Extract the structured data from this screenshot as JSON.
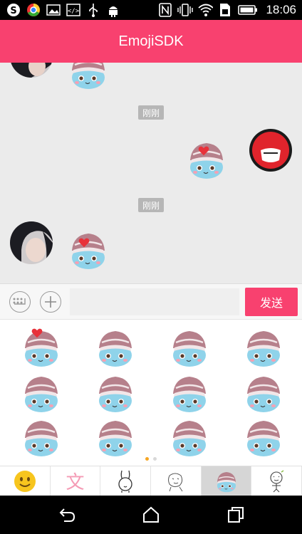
{
  "status_bar": {
    "time": "18:06",
    "icons": [
      "s-app-icon",
      "chrome-icon",
      "gallery-icon",
      "code-icon",
      "usb-icon",
      "android-icon",
      "nfc-icon",
      "vibrate-icon",
      "wifi-icon",
      "sim-icon",
      "battery-icon"
    ]
  },
  "header": {
    "title": "EmojiSDK"
  },
  "chat": {
    "timestamp_1": "刚刚",
    "timestamp_2": "刚刚"
  },
  "input_bar": {
    "send_label": "发送",
    "text_value": ""
  },
  "sticker_panel": {
    "rows": 3,
    "cols": 4,
    "page_count": 2,
    "current_page": 1,
    "active_dot_color": "#f5a623",
    "inactive_dot_color": "#d8d8d8"
  },
  "tabs": [
    {
      "name": "emoji-tab",
      "icon": "smiley-face-icon"
    },
    {
      "name": "text-tab",
      "label": "文"
    },
    {
      "name": "rabbit-tab",
      "icon": "rabbit-sticker-icon"
    },
    {
      "name": "sketch-tab",
      "icon": "sketch-character-icon"
    },
    {
      "name": "hat-bird-tab",
      "icon": "hat-bird-sticker-icon",
      "active": true
    },
    {
      "name": "doodle-tab",
      "icon": "doodle-character-icon"
    }
  ],
  "colors": {
    "accent": "#f8416f",
    "chat_bg": "#ebebeb",
    "timestamp_bg": "#b6b6b6"
  }
}
